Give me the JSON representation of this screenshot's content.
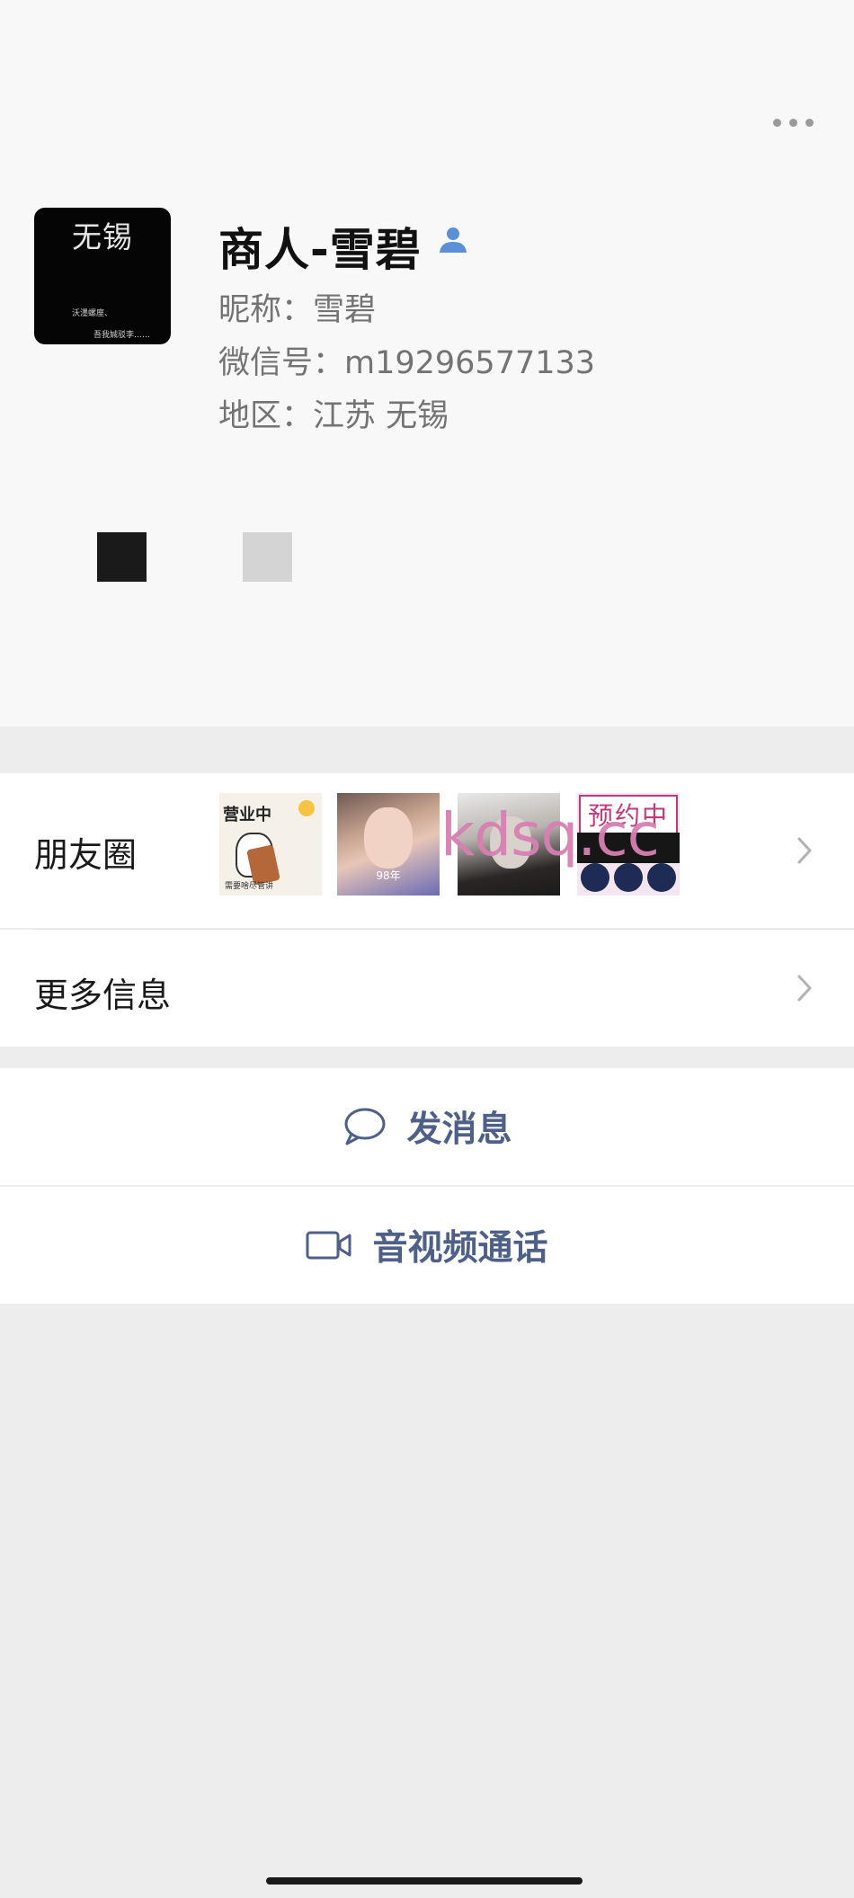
{
  "profile": {
    "avatar_text": "无锡",
    "avatar_line1": "沃濹螺庢、",
    "avatar_line2": "吾我娍驳李……",
    "name": "商人-雪碧",
    "nickname": "昵称：雪碧",
    "wechat_id": "微信号：m19296577133",
    "region": "地区：江苏  无锡"
  },
  "moments": {
    "label": "朋友圈",
    "thumb1_text": "营业中",
    "thumb1_caption": "需要啥尽管讲",
    "thumb2_caption": "98年",
    "thumb4_text": "预约中"
  },
  "more_info": {
    "label": "更多信息"
  },
  "actions": {
    "send_message": "发消息",
    "av_call": "音视频通话"
  },
  "watermark": "kdsq.cc",
  "colors": {
    "accent_text": "#4f6088",
    "page_background": "#ededed",
    "card_background": "#ffffff"
  }
}
